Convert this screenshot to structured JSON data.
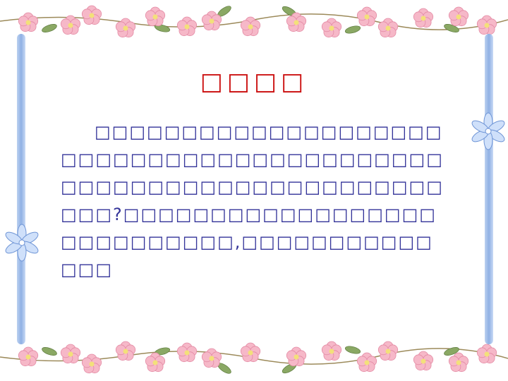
{
  "slide": {
    "title": "□□□□",
    "body": "□□□□□□□□□□□□□□□□□□□□□□□□□□□□□□□□□□□□□□□□□□□□□□□□□□□□□□□□□□□□□□□□□□□?□□□□□□□□□□□□□□□□□□□□□□□□□□□□,□□□□□□□□□□□□□□"
  },
  "colors": {
    "title": "#cc1111",
    "body": "#333399",
    "blossom": "#f6b8c8",
    "leaf": "#8aa864",
    "ribbon": "#8fb0e4"
  },
  "icons": {
    "border": "cherry-blossom-garland",
    "side": "blue-snowflake-flower"
  }
}
